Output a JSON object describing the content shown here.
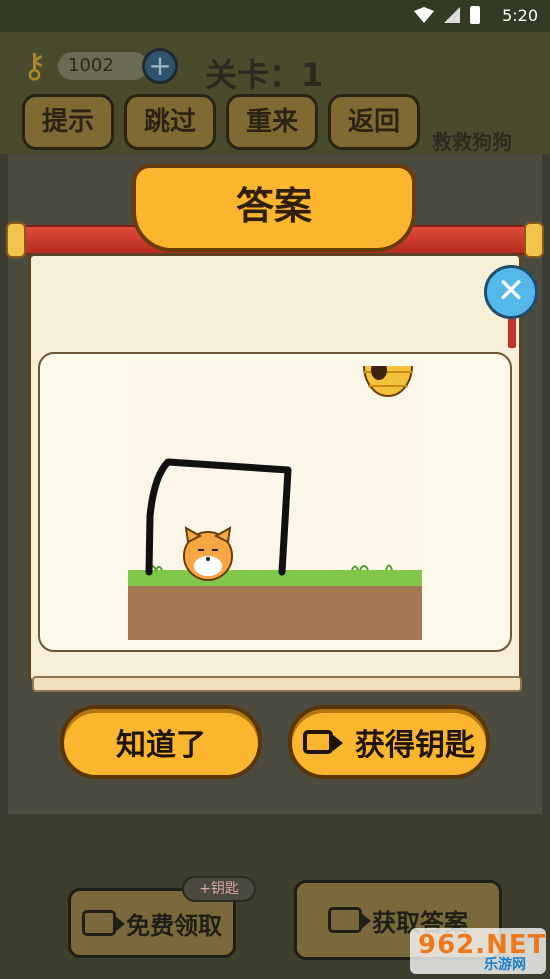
{
  "status_bar": {
    "time": "5:20"
  },
  "hud": {
    "key_count": "1002",
    "plus_symbol": "+",
    "level_label": "关卡：1",
    "buttons": [
      "提示",
      "跳过",
      "重来",
      "返回"
    ],
    "game_name": "救救狗狗"
  },
  "dialog": {
    "title": "答案",
    "close_symbol": "✕",
    "ok_label": "知道了",
    "get_key_label": "获得钥匙"
  },
  "bottom": {
    "free_claim_label": "免费领取",
    "plus_key_tag": "+钥匙",
    "get_answer_label": "获取答案"
  },
  "watermark": {
    "main": "962.NET",
    "sub": "乐游网"
  },
  "icons": [
    "wifi-icon",
    "no-signal-icon",
    "battery-icon",
    "key-icon",
    "plus-icon",
    "close-icon",
    "video-camera-icon",
    "beehive-icon",
    "dog-icon"
  ],
  "colors": {
    "accent": "#fbb62f",
    "close_blue": "#55b8ea",
    "scroll_red": "#e04a3a"
  }
}
